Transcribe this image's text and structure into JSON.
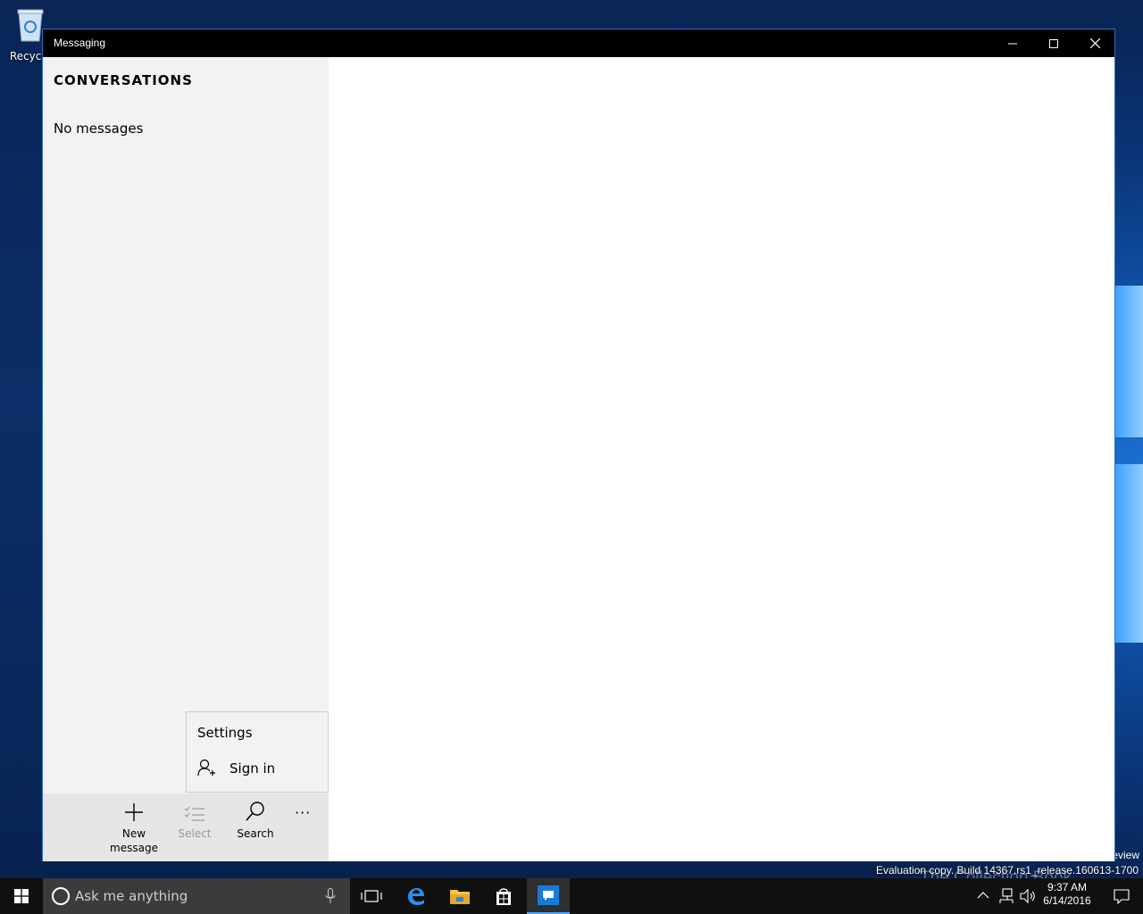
{
  "desktop": {
    "recycle_label": "Recycle",
    "eval_top": "eview",
    "eval_text": "Evaluation copy. Build 14367.rs1_release.160613-1700",
    "watermark": "The Collection Book"
  },
  "window": {
    "title": "Messaging",
    "conversations_header": "CONVERSATIONS",
    "empty_text": "No messages",
    "menu": {
      "settings": "Settings",
      "sign_in": "Sign in"
    },
    "commands": {
      "new_message_1": "New",
      "new_message_2": "message",
      "select": "Select",
      "search": "Search",
      "more": "···"
    }
  },
  "taskbar": {
    "search_placeholder": "Ask me anything",
    "time": "9:37 AM",
    "date": "6/14/2016"
  },
  "colors": {
    "accent": "#4fa3ff",
    "titlebar": "#000000",
    "left_pane": "#f2f2f2"
  }
}
